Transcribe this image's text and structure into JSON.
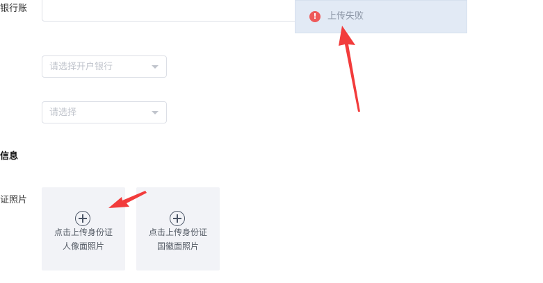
{
  "form": {
    "bank_account_label": "银行账",
    "bank_select": {
      "placeholder": "请选择开户银行"
    },
    "other_select": {
      "placeholder": "请选择"
    },
    "section_title": "信息",
    "id_photo_label": "证照片",
    "upload_front": {
      "line1": "点击上传身份证",
      "line2": "人像面照片"
    },
    "upload_back": {
      "line1": "点击上传身份证",
      "line2": "国徽面照片"
    }
  },
  "toast": {
    "message": "上传失败",
    "icon": "error-circle-icon",
    "icon_glyph": "!"
  },
  "annotations": {
    "arrow_color": "#f23b3b"
  },
  "colors": {
    "error": "#ee5a5a",
    "toast_bg": "#e2eaf5",
    "upload_bg": "#f2f3f7"
  }
}
